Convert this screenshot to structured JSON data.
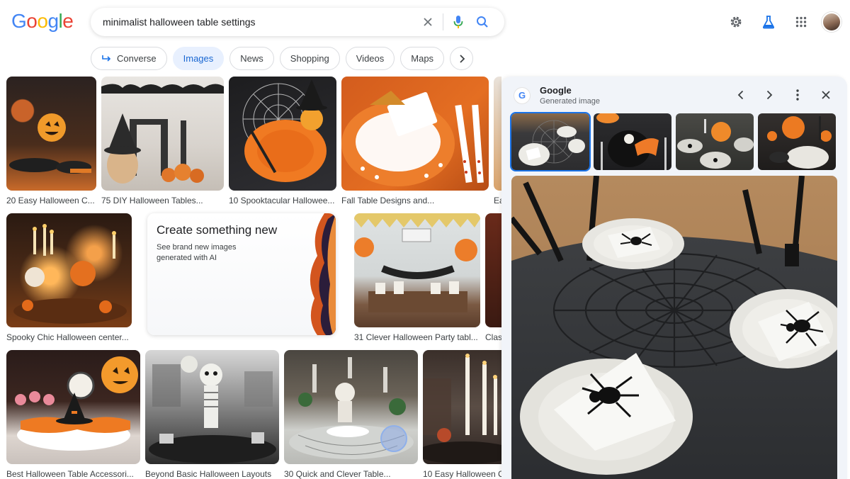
{
  "logo": {
    "letters": [
      "G",
      "o",
      "o",
      "g",
      "l",
      "e"
    ],
    "colors": [
      "#4285f4",
      "#ea4335",
      "#fbbc05",
      "#4285f4",
      "#34a853",
      "#ea4335"
    ]
  },
  "search": {
    "query": "minimalist halloween table settings"
  },
  "chips": [
    {
      "label": "Converse",
      "active": false
    },
    {
      "label": "Images",
      "active": true
    },
    {
      "label": "News",
      "active": false
    },
    {
      "label": "Shopping",
      "active": false
    },
    {
      "label": "Videos",
      "active": false
    },
    {
      "label": "Maps",
      "active": false
    }
  ],
  "results": [
    {
      "caption": "20 Easy Halloween C..."
    },
    {
      "caption": "75 DIY Halloween Tables..."
    },
    {
      "caption": "10 Spooktacular Hallowee..."
    },
    {
      "caption": "Fall Table Designs and..."
    },
    {
      "caption": "Ea"
    },
    {
      "caption": "Spooky Chic Halloween center..."
    },
    {
      "caption": "31 Clever Halloween Party tabl..."
    },
    {
      "caption": "Clas"
    },
    {
      "caption": "Best Halloween Table Accessori..."
    },
    {
      "caption": "Beyond Basic Halloween Layouts"
    },
    {
      "caption": "30 Quick and Clever Table..."
    },
    {
      "caption": "10 Easy Halloween Ce"
    }
  ],
  "ai_card": {
    "title": "Create something new",
    "subtitle": "See brand new images generated with AI"
  },
  "panel": {
    "source_name": "Google",
    "source_sub": "Generated image",
    "badge": "G"
  },
  "icons": [
    "clear-icon",
    "mic-icon",
    "search-icon",
    "settings-gear-icon",
    "labs-flask-icon",
    "apps-grid-icon",
    "converse-arrow-icon",
    "chevron-right-icon",
    "chevron-left-icon",
    "more-vert-icon",
    "close-icon"
  ]
}
